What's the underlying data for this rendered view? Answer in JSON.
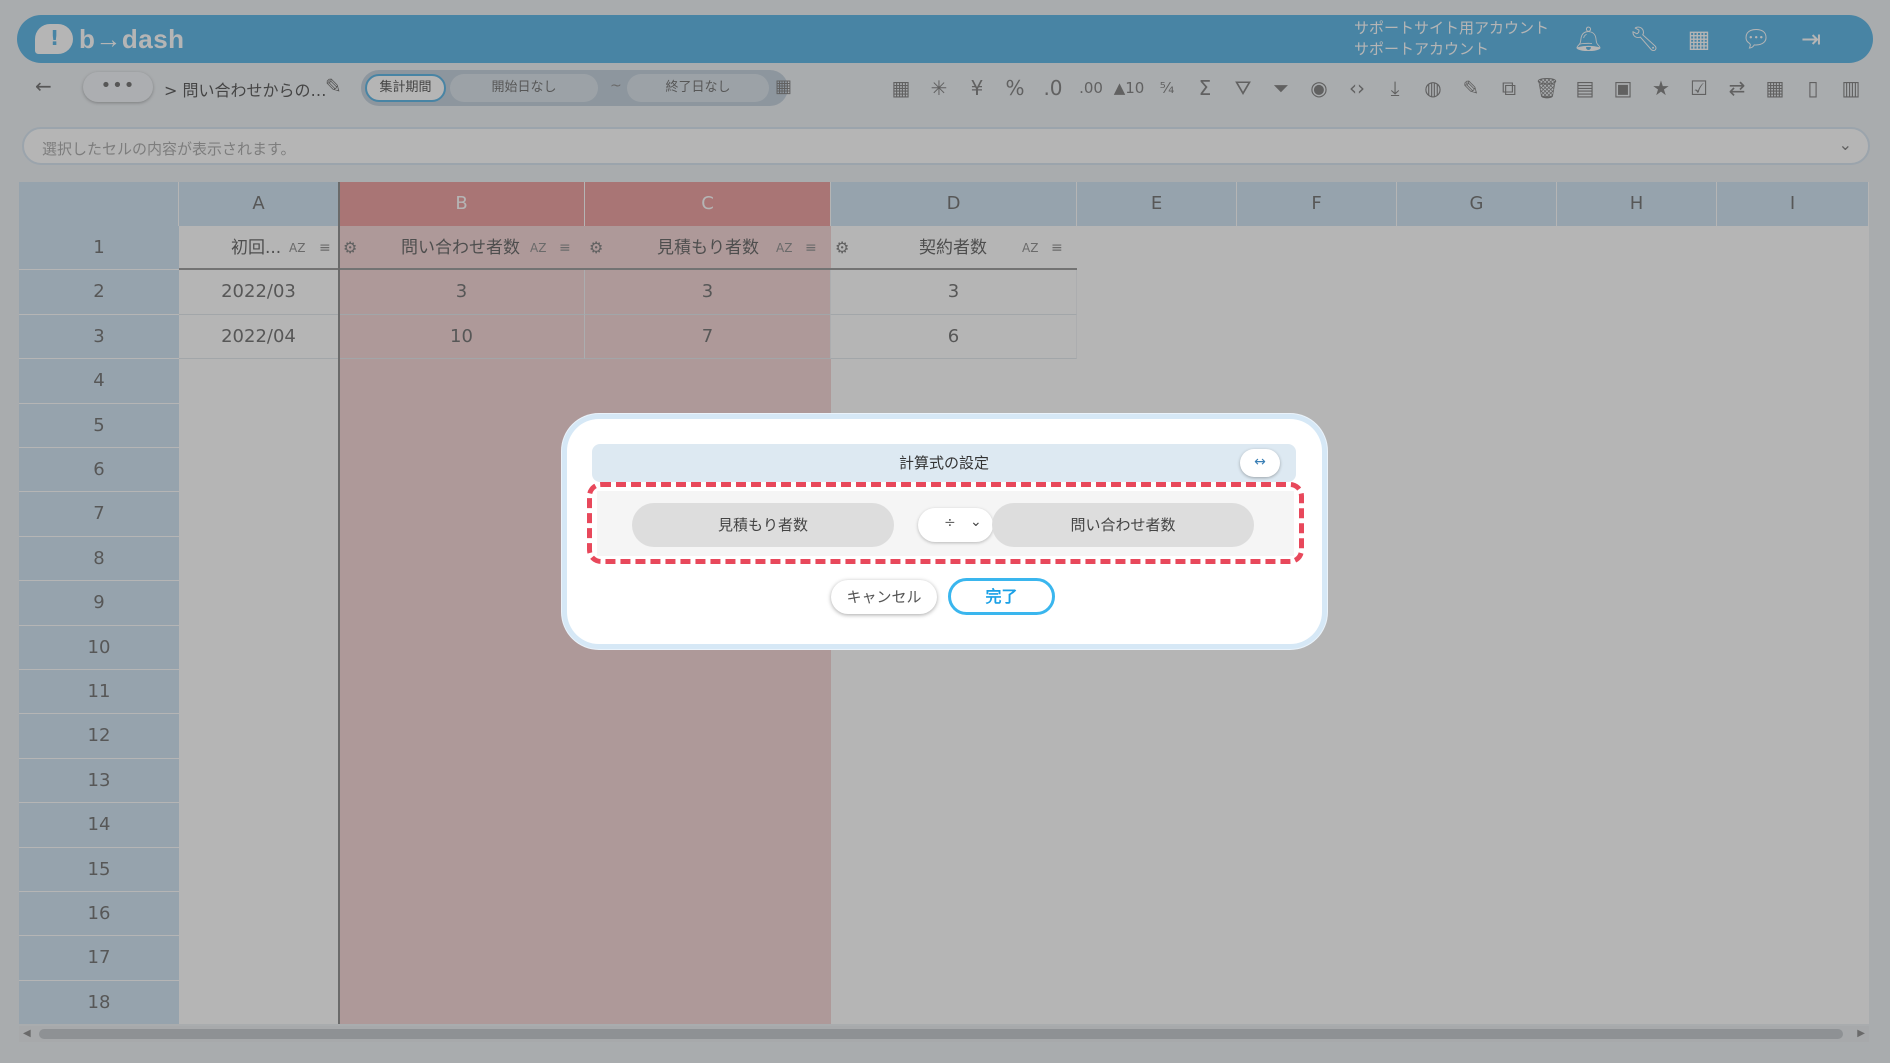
{
  "app": {
    "logo_text": "b→dash",
    "account_line1": "サポートサイト用アカウント",
    "account_line2": "サポートアカウント"
  },
  "topbar_icons": [
    "bell-icon",
    "wrench-icon",
    "apps-grid-icon",
    "chat-icon",
    "logout-icon"
  ],
  "toolbar": {
    "more_label": "•••",
    "breadcrumb": "> 問い合わせからの…",
    "period_label": "集計期間",
    "start_label": "開始日なし",
    "separator": "~",
    "end_label": "終了日なし",
    "tools": [
      {
        "name": "table-icon",
        "glyph": "▦"
      },
      {
        "name": "loading-icon",
        "glyph": "✳"
      },
      {
        "name": "yen-icon",
        "glyph": "¥"
      },
      {
        "name": "percent-icon",
        "glyph": "%"
      },
      {
        "name": "decimal-decrease-icon",
        "glyph": ".0"
      },
      {
        "name": "decimal-increase-icon",
        "glyph": ".00"
      },
      {
        "name": "rank-icon",
        "glyph": "▲10"
      },
      {
        "name": "fraction-icon",
        "glyph": "⁵⁄₄"
      },
      {
        "name": "sum-icon",
        "glyph": "Σ"
      },
      {
        "name": "filter-clear-icon",
        "glyph": "⛛"
      },
      {
        "name": "filter-icon",
        "glyph": "⏷"
      },
      {
        "name": "eye-icon",
        "glyph": "◉"
      },
      {
        "name": "code-icon",
        "glyph": "‹›"
      },
      {
        "name": "download-icon",
        "glyph": "⤓"
      },
      {
        "name": "chart-icon",
        "glyph": "◍"
      },
      {
        "name": "edit-note-icon",
        "glyph": "✎"
      },
      {
        "name": "copy-icon",
        "glyph": "⧉"
      },
      {
        "name": "trash-icon",
        "glyph": "🗑"
      },
      {
        "name": "archive-icon",
        "glyph": "▤"
      },
      {
        "name": "unarchive-icon",
        "glyph": "▣"
      },
      {
        "name": "star-icon",
        "glyph": "★"
      },
      {
        "name": "user-check-icon",
        "glyph": "☑"
      },
      {
        "name": "sync-icon",
        "glyph": "⇄"
      },
      {
        "name": "calendar-icon",
        "glyph": "▦"
      },
      {
        "name": "document-icon",
        "glyph": "▯"
      },
      {
        "name": "clipboard-icon",
        "glyph": "▥"
      }
    ]
  },
  "formula_bar": {
    "placeholder": "選択したセルの内容が表示されます。"
  },
  "grid": {
    "columns": [
      "A",
      "B",
      "C",
      "D",
      "E",
      "F",
      "G",
      "H",
      "I"
    ],
    "selected_columns": [
      "B",
      "C"
    ],
    "header_row": [
      "初回...",
      "問い合わせ者数",
      "見積もり者数",
      "契約者数"
    ],
    "sort_label": "AZ",
    "rows": [
      {
        "num": "1"
      },
      {
        "num": "2",
        "cells": [
          "2022/03",
          "3",
          "3",
          "3"
        ]
      },
      {
        "num": "3",
        "cells": [
          "2022/04",
          "10",
          "7",
          "6"
        ]
      },
      {
        "num": "4"
      },
      {
        "num": "5"
      },
      {
        "num": "6"
      },
      {
        "num": "7"
      },
      {
        "num": "8"
      },
      {
        "num": "9"
      },
      {
        "num": "10"
      },
      {
        "num": "11"
      },
      {
        "num": "12"
      },
      {
        "num": "13"
      },
      {
        "num": "14"
      },
      {
        "num": "15"
      },
      {
        "num": "16"
      },
      {
        "num": "17"
      },
      {
        "num": "18"
      }
    ]
  },
  "dialog": {
    "title": "計算式の設定",
    "expand_label": "↔",
    "left_operand": "見積もり者数",
    "operator": "÷",
    "right_operand": "問い合わせ者数",
    "cancel_label": "キャンセル",
    "done_label": "完了"
  },
  "colors": {
    "brand": "#3aa6e0",
    "highlight_dash": "#e8485b",
    "selected_column": "#e98a8a"
  }
}
